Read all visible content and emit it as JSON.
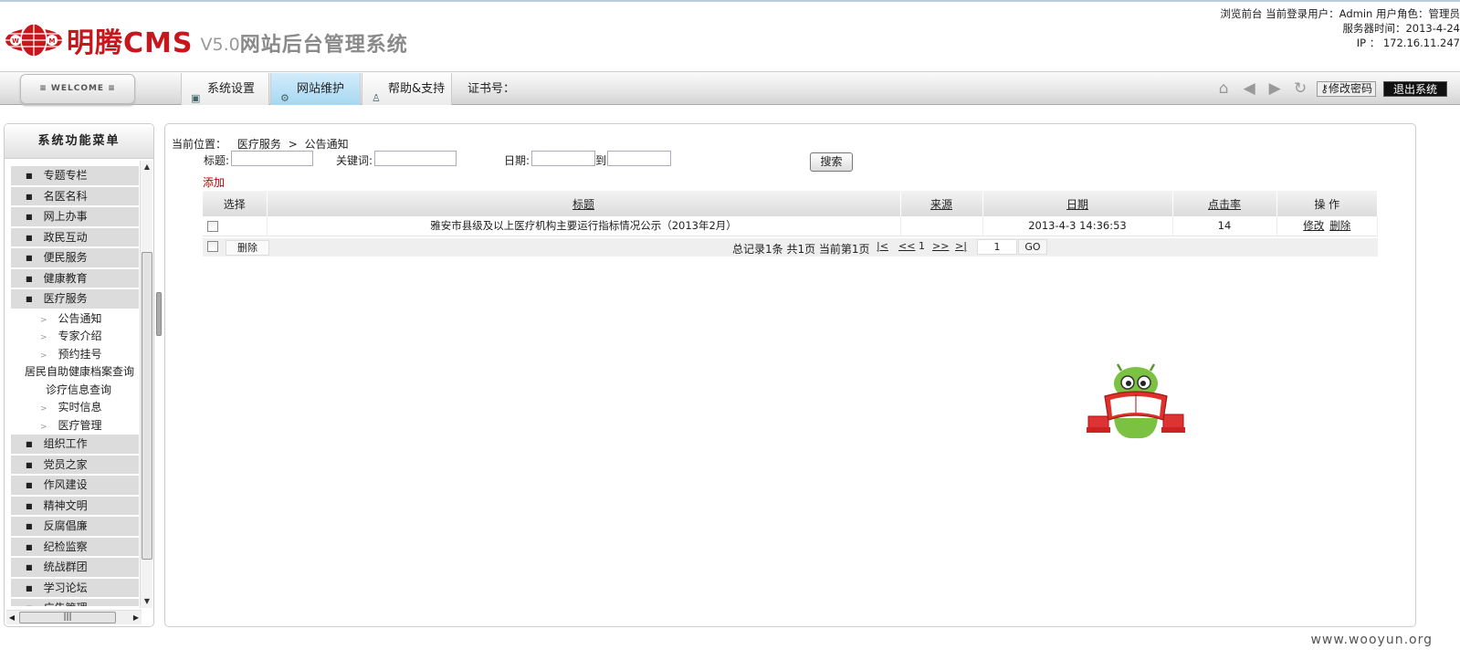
{
  "header": {
    "brand": "明腾CMS",
    "version": "V5.0",
    "system_name": "网站后台管理系统",
    "user_line": "浏览前台 当前登录用户：Admin 用户角色：管理员",
    "server_time": "服务器时间：2013-4-24",
    "ip": "IP ： 172.16.11.247"
  },
  "nav": {
    "welcome": "≡ WELCOME ≡",
    "tabs": [
      {
        "label": "系统设置",
        "icon": "monitor-icon"
      },
      {
        "label": "网站维护",
        "icon": "gear-icon"
      },
      {
        "label": "帮助&支持",
        "icon": "user-icon"
      }
    ],
    "cert_label": "证书号：",
    "change_password": "修改密码",
    "logout": "退出系统"
  },
  "sidebar": {
    "title": "系统功能菜单",
    "items": [
      {
        "label": "专题专栏",
        "type": "cat"
      },
      {
        "label": "名医名科",
        "type": "cat"
      },
      {
        "label": "网上办事",
        "type": "cat"
      },
      {
        "label": "政民互动",
        "type": "cat"
      },
      {
        "label": "便民服务",
        "type": "cat"
      },
      {
        "label": "健康教育",
        "type": "cat"
      },
      {
        "label": "医疗服务",
        "type": "cat"
      },
      {
        "label": "公告通知",
        "type": "sub"
      },
      {
        "label": "专家介绍",
        "type": "sub"
      },
      {
        "label": "预约挂号",
        "type": "sub"
      },
      {
        "label": "居民自助健康档案查询",
        "type": "plain"
      },
      {
        "label": "诊疗信息查询",
        "type": "plain2"
      },
      {
        "label": "实时信息",
        "type": "sub"
      },
      {
        "label": "医疗管理",
        "type": "sub"
      },
      {
        "label": "组织工作",
        "type": "cat"
      },
      {
        "label": "党员之家",
        "type": "cat"
      },
      {
        "label": "作风建设",
        "type": "cat"
      },
      {
        "label": "精神文明",
        "type": "cat"
      },
      {
        "label": "反腐倡廉",
        "type": "cat"
      },
      {
        "label": "纪检监察",
        "type": "cat"
      },
      {
        "label": "统战群团",
        "type": "cat"
      },
      {
        "label": "学习论坛",
        "type": "cat"
      },
      {
        "label": "广告管理",
        "type": "cat"
      }
    ]
  },
  "main": {
    "crumb_label": "当前位置：",
    "crumb_section": "医疗服务",
    "crumb_sep": ">",
    "crumb_page": "公告通知",
    "search": {
      "title_label": "标题:",
      "keyword_label": "关键词:",
      "date_label": "日期:",
      "to_label": "到",
      "button": "搜索"
    },
    "add": "添加",
    "columns": [
      "选择",
      "标题",
      "来源",
      "日期",
      "点击率",
      "操 作"
    ],
    "rows": [
      {
        "title": "雅安市县级及以上医疗机构主要运行指标情况公示（2013年2月）",
        "source": "",
        "date": "2013-4-3 14:36:53",
        "clicks": "14",
        "edit": "修改",
        "delete": "删除"
      }
    ],
    "pager": {
      "delete": "删除",
      "info": "总记录1条  共1页  当前第1页",
      "first": "|<",
      "prev": "<<",
      "current": "1",
      "next": ">>",
      "last": ">|",
      "page_input": "1",
      "go": "GO"
    }
  },
  "watermark": "www.wooyun.org",
  "colors": {
    "brand_red": "#c8161d",
    "active_tab": "#a6d8f2",
    "add_link": "#bb0000"
  }
}
